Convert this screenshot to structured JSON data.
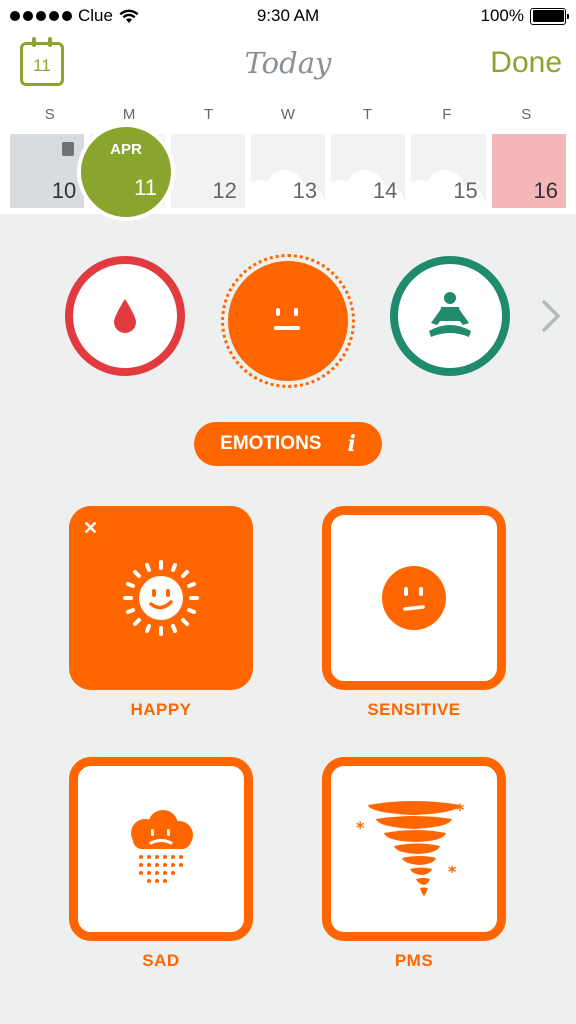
{
  "status_bar": {
    "carrier": "Clue",
    "time": "9:30 AM",
    "battery": "100%"
  },
  "header": {
    "calendar_day": "11",
    "title": "Today",
    "done_label": "Done"
  },
  "week": {
    "weekdays": [
      "S",
      "M",
      "T",
      "W",
      "T",
      "F",
      "S"
    ],
    "days": [
      "10",
      "11",
      "12",
      "13",
      "14",
      "15",
      "16"
    ],
    "today_month": "APR",
    "today_day": "11"
  },
  "categories": {
    "badge_label": "EMOTIONS",
    "badge_info": "i"
  },
  "options": [
    {
      "label": "HAPPY",
      "selected": true
    },
    {
      "label": "SENSITIVE",
      "selected": false
    },
    {
      "label": "SAD",
      "selected": false
    },
    {
      "label": "PMS",
      "selected": false
    }
  ],
  "colors": {
    "brand_green": "#8aa52e",
    "emotion_orange": "#ff6600",
    "period_red": "#e23b3f",
    "meditate_green": "#1f8a6c",
    "period_day_pink": "#f4b6b9"
  },
  "icons": {
    "calendar": "calendar-icon",
    "period": "blood-drop-icon",
    "emotion": "neutral-face-icon",
    "meditation": "meditation-icon",
    "next": "chevron-right-icon",
    "happy": "sun-face-icon",
    "sensitive": "worried-face-icon",
    "sad": "rain-cloud-icon",
    "pms": "tornado-icon"
  }
}
